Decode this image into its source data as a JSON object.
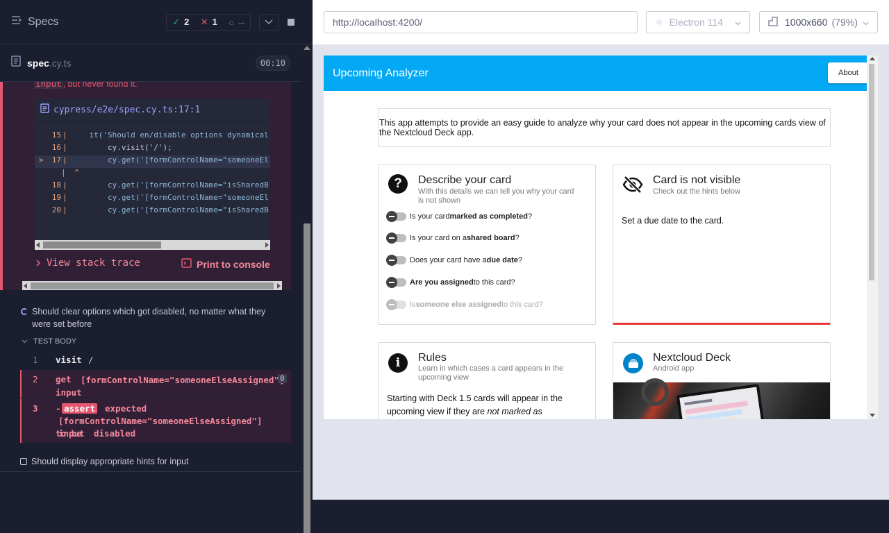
{
  "runner": {
    "specs_label": "Specs",
    "stats": {
      "passed": "2",
      "failed": "1",
      "pending": "--"
    },
    "spec_file": {
      "name": "spec",
      "ext": ".cy.ts",
      "duration": "00:10"
    },
    "error": {
      "message_tail_code": "input",
      "message_tail_text": ", but never found it.",
      "file_link": "cypress/e2e/spec.cy.ts:17:1",
      "code_lines": [
        {
          "num": "15",
          "text": "    it('Should en/disable options dynamical",
          "marker": ""
        },
        {
          "num": "16",
          "text": "        cy.visit('/');",
          "marker": ""
        },
        {
          "num": "17",
          "text": "        cy.get('[formControlName=\"someoneEl",
          "marker": ">"
        },
        {
          "num": "",
          "text": "  ^",
          "marker": ""
        },
        {
          "num": "18",
          "text": "        cy.get('[formControlName=\"isSharedB",
          "marker": ""
        },
        {
          "num": "19",
          "text": "        cy.get('[formControlName=\"someoneEl",
          "marker": ""
        },
        {
          "num": "20",
          "text": "        cy.get('[formControlName=\"isSharedB",
          "marker": ""
        }
      ],
      "view_stack_trace": "View stack trace",
      "print_to_console": "Print to console"
    },
    "running_test": "Should clear options which got disabled, no matter what they were set before",
    "test_body_label": "TEST BODY",
    "commands": [
      {
        "num": "1",
        "name": "visit",
        "msg": "/",
        "count": ""
      },
      {
        "num": "2",
        "name": "get",
        "msg": "[formControlName=\"someoneElseAssigned\"] input",
        "count": "0"
      },
      {
        "num": "3",
        "name": "-assert",
        "msg": "expected [formControlName=\"someoneElseAssigned\"] input to be disabled",
        "count": ""
      }
    ],
    "assert_badge": "assert",
    "assert_expected": "expected",
    "assert_selector": "[formControlName=\"someoneElseAssigned\"] input",
    "assert_to_be": "to be",
    "assert_disabled": "disabled",
    "pending_test": "Should display appropriate hints for input"
  },
  "browser": {
    "url": "http://localhost:4200/",
    "browser_name": "Electron 114",
    "viewport": "1000x660",
    "zoom": "(79%)"
  },
  "app": {
    "title": "Upcoming Analyzer",
    "about": "About",
    "intro": {
      "text1": "This app attempts to provide an easy guide to analyze ",
      "link1": "why your card does not appear in the upcoming cards view",
      "text2": " of the ",
      "link2": "Nextcloud Deck",
      "text3": " app."
    },
    "describe": {
      "title": "Describe your card",
      "subtitle": "With this details we can tell you why your card is not shown",
      "toggles": [
        {
          "pre": "Is your card ",
          "bold": "marked as completed",
          "post": "?"
        },
        {
          "pre": "Is your card on a ",
          "bold": "shared board",
          "post": "?"
        },
        {
          "pre": "Does your card have a ",
          "bold": "due date",
          "post": "?"
        },
        {
          "pre": "",
          "bold": "Are you assigned",
          "post": " to this card?"
        },
        {
          "pre": "Is ",
          "bold": "someone else assigned",
          "post": " to this card?"
        }
      ]
    },
    "visible": {
      "title": "Card is not visible",
      "subtitle": "Check out the hints below",
      "hint": "Set a due date to the card."
    },
    "rules": {
      "title": "Rules",
      "subtitle": "Learn in which cases a card appears in the upcoming view",
      "body_pre": "Starting with Deck 1.5 cards will appear in the upcoming view if they are ",
      "body_em": "not marked as"
    },
    "deck": {
      "title": "Nextcloud Deck",
      "subtitle": "Android app"
    }
  },
  "colors": {
    "accent": "#03a9f4",
    "error": "#e45770",
    "pass": "#1fa971"
  }
}
